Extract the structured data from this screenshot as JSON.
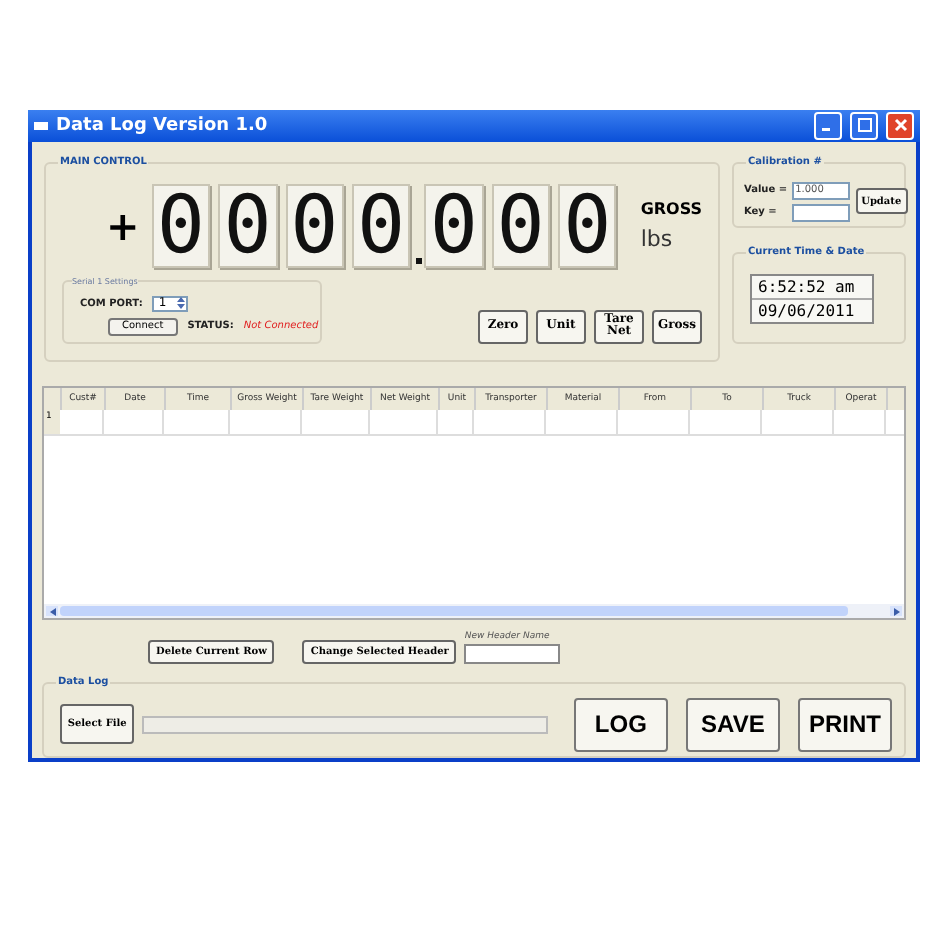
{
  "window": {
    "title": "Data Log Version 1.0"
  },
  "main_control": {
    "title": "MAIN CONTROL",
    "sign": "+",
    "digits": [
      {
        "digit": "0",
        "point": false
      },
      {
        "digit": "0",
        "point": false
      },
      {
        "digit": "0",
        "point": false
      },
      {
        "digit": "0",
        "point": true
      },
      {
        "digit": "0",
        "point": false
      },
      {
        "digit": "0",
        "point": false
      },
      {
        "digit": "0",
        "point": false
      }
    ],
    "mode": "GROSS",
    "unit": "lbs",
    "serial": {
      "title": "Serial 1 Settings",
      "com_port_label": "COM PORT:",
      "com_port": "1",
      "connect_button": "Connect",
      "status_label": "STATUS:",
      "status": "Not Connected"
    },
    "buttons": [
      "Zero",
      "Unit",
      "Tare Net",
      "Gross"
    ]
  },
  "calibration": {
    "title": "Calibration #",
    "value_label": "Value =",
    "value": "1.000",
    "key_label": "Key =",
    "button": "Update"
  },
  "clock": {
    "title": "Current Time & Date",
    "time": "6:52:52 am",
    "date": "09/06/2011"
  },
  "table": {
    "columns": [
      "Cust#",
      "Date",
      "Time",
      "Gross Weight",
      "Tare Weight",
      "Net Weight",
      "Unit",
      "Transporter",
      "Material",
      "From",
      "To",
      "Truck",
      "Operat"
    ],
    "rows": [
      {
        "number": "1"
      }
    ]
  },
  "header_tools": {
    "delete_button": "Delete Current Row",
    "change_button": "Change Selected Header",
    "new_header_label": "New Header Name"
  },
  "data_log": {
    "title": "Data Log",
    "select_button": "Select File",
    "buttons": [
      "LOG",
      "SAVE",
      "PRINT"
    ]
  }
}
